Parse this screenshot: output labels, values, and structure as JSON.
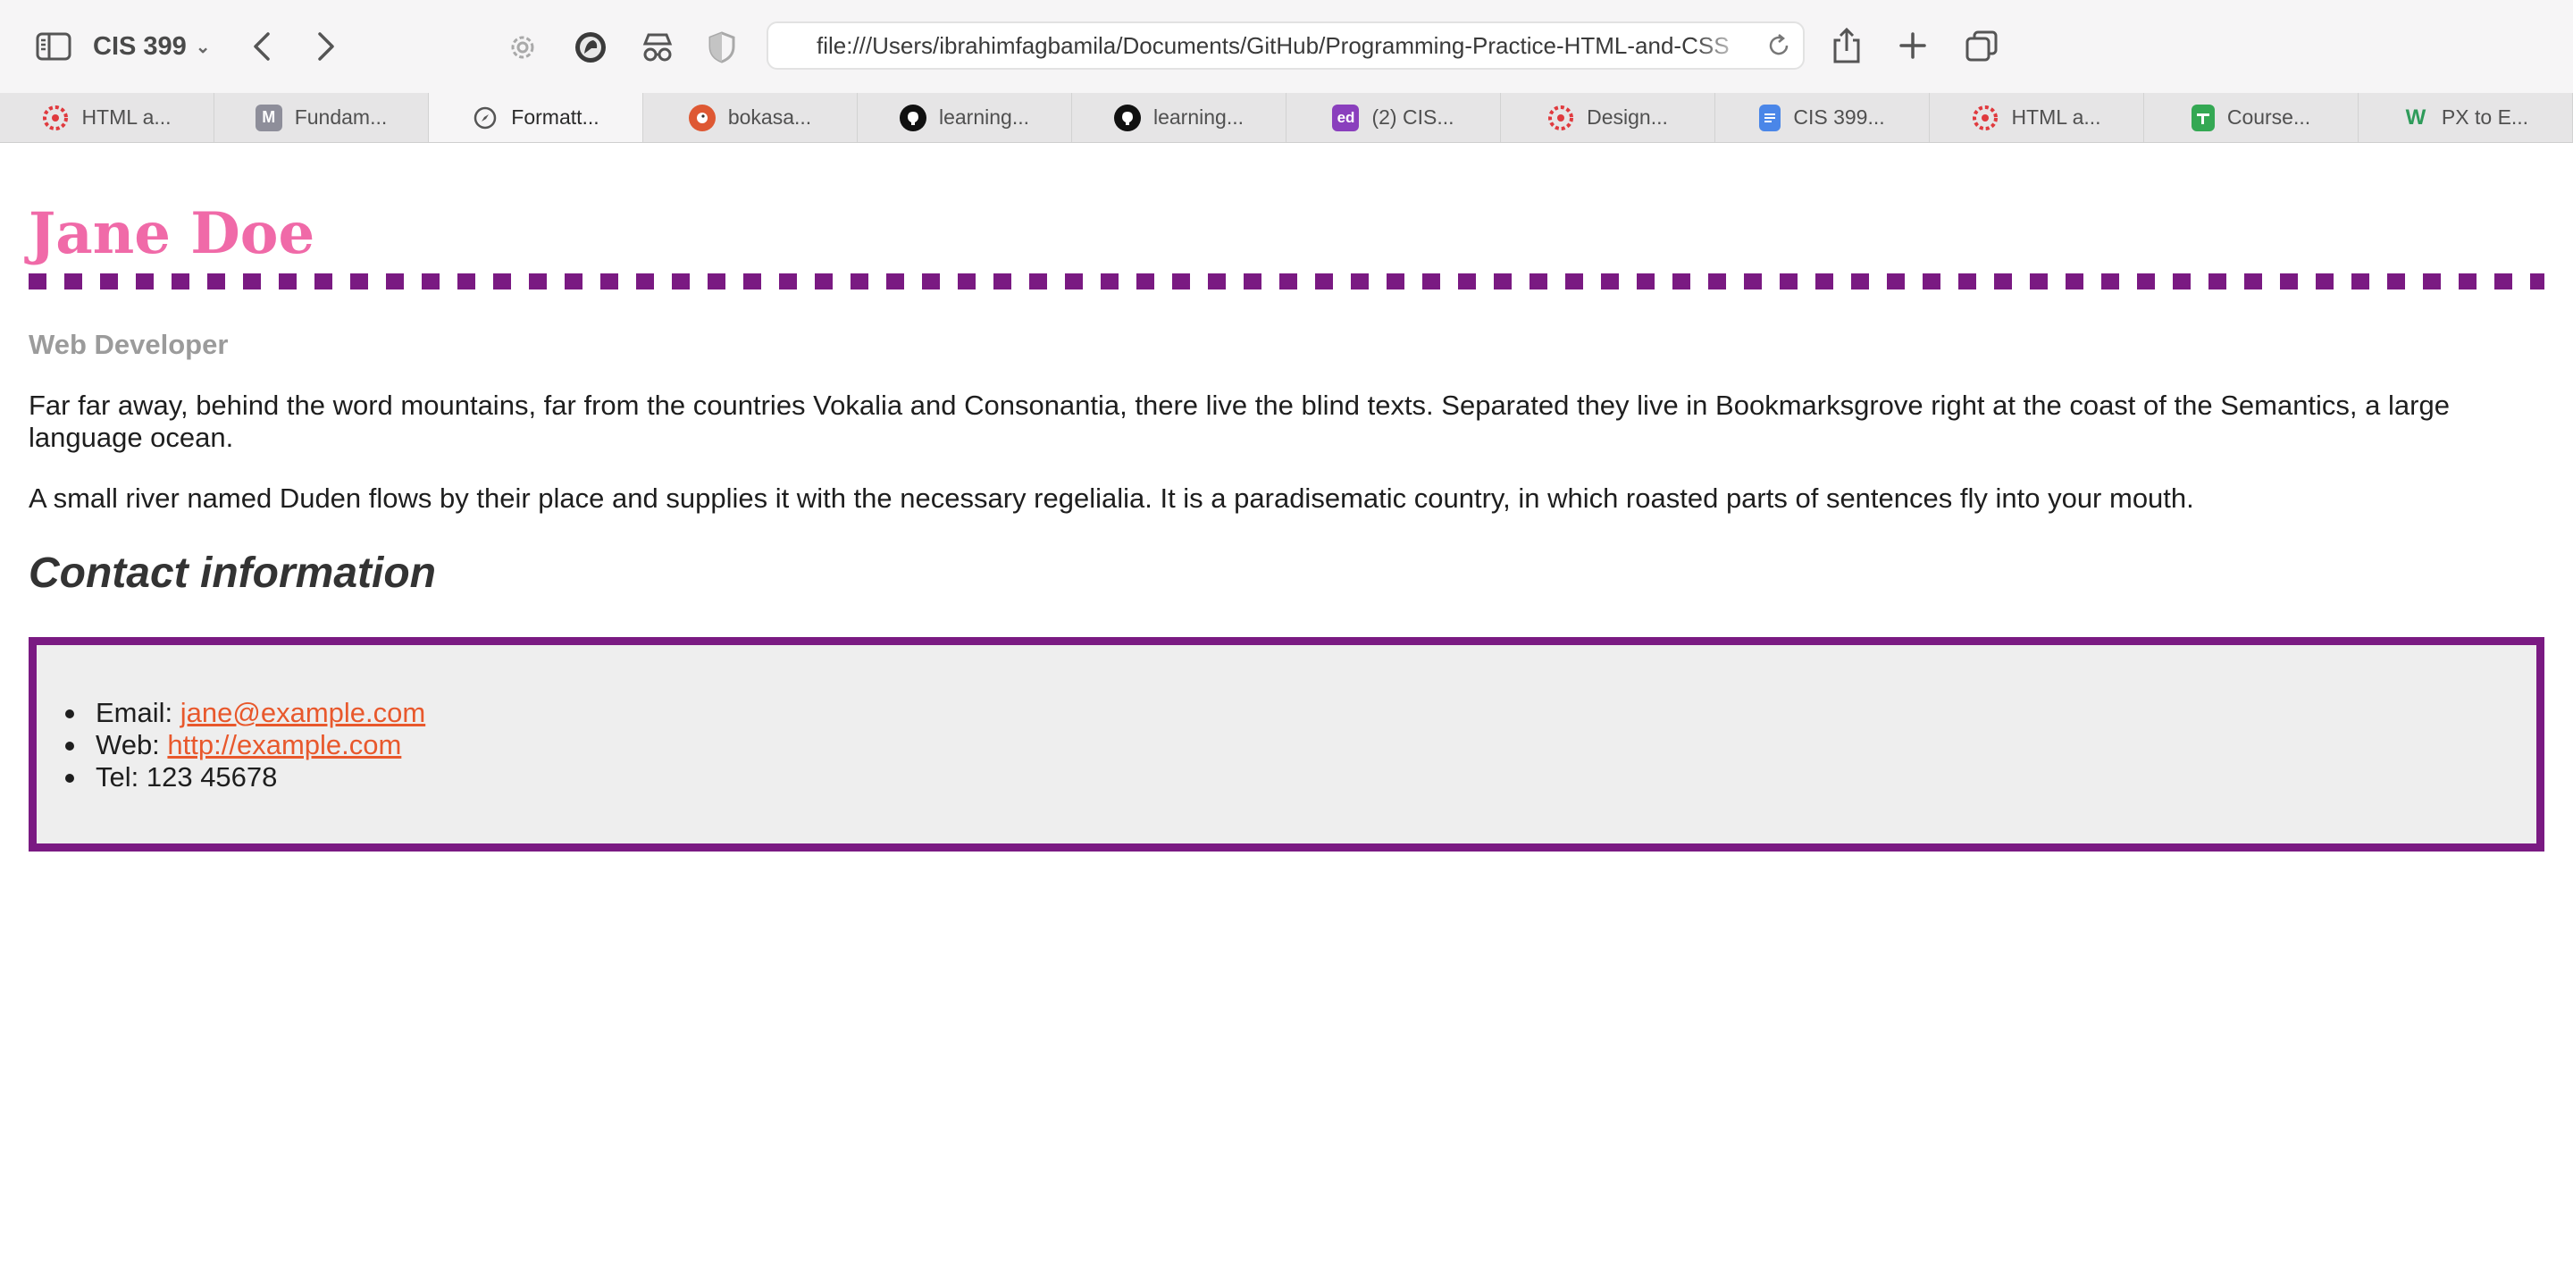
{
  "browser": {
    "tab_group": "CIS 399",
    "address_url": "file:///Users/ibrahimfagbamila/Documents/GitHub/Programming-Practice-HTML-and-CSS"
  },
  "tabs": [
    {
      "label": "HTML a...",
      "icon": "red-gear-icon"
    },
    {
      "label": "Fundam...",
      "icon": "m-letter-icon",
      "icon_text": "M"
    },
    {
      "label": "Formatt...",
      "icon": "compass-icon",
      "active": true
    },
    {
      "label": "bokasa...",
      "icon": "duckduckgo-icon"
    },
    {
      "label": "learning...",
      "icon": "github-icon"
    },
    {
      "label": "learning...",
      "icon": "github-icon"
    },
    {
      "label": "(2) CIS...",
      "icon": "ed-icon",
      "icon_text": "ed"
    },
    {
      "label": "Design...",
      "icon": "red-gear-icon"
    },
    {
      "label": "CIS 399...",
      "icon": "google-docs-icon"
    },
    {
      "label": "HTML a...",
      "icon": "red-gear-icon"
    },
    {
      "label": "Course...",
      "icon": "google-sheets-icon"
    },
    {
      "label": "PX to E...",
      "icon": "w3-icon"
    }
  ],
  "page": {
    "name": "Jane Doe",
    "job_title": "Web Developer",
    "paragraphs": [
      "Far far away, behind the word mountains, far from the countries Vokalia and Consonantia, there live the blind texts. Separated they live in Bookmarksgrove right at the coast of the Semantics, a large language ocean.",
      "A small river named Duden flows by their place and supplies it with the necessary regelialia. It is a paradisematic country, in which roasted parts of sentences fly into your mouth."
    ],
    "contact_heading": "Contact information",
    "contact": {
      "email_label": "Email:",
      "email": "jane@example.com",
      "web_label": "Web:",
      "web": "http://example.com",
      "tel": "Tel: 123 45678"
    }
  },
  "colors": {
    "name": "#f06aa8",
    "rule": "#7a1a82",
    "link": "#e8582c",
    "job_title": "#9b9b9b",
    "box_bg": "#eeeeee"
  }
}
